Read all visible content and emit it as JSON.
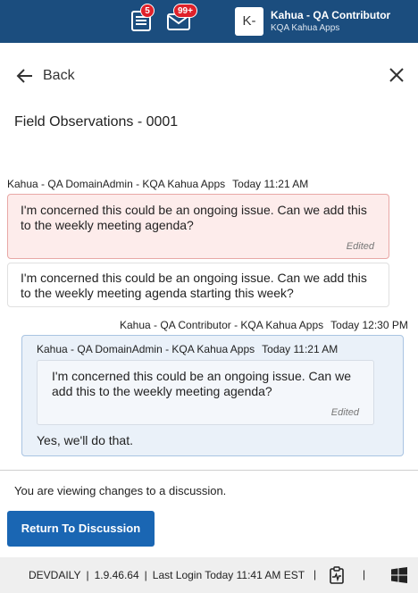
{
  "topbar": {
    "tasks_badge": "5",
    "messages_badge": "99+",
    "avatar_initials": "K-",
    "user_name": "Kahua - QA Contributor",
    "user_org": "KQA Kahua Apps"
  },
  "nav": {
    "back_label": "Back"
  },
  "page": {
    "title": "Field Observations - 0001"
  },
  "messages": [
    {
      "author": "Kahua - QA DomainAdmin - KQA Kahua Apps",
      "timestamp": "Today 11:21 AM",
      "original_text": "I'm concerned this could be an ongoing issue.  Can we add this to the weekly meeting agenda?",
      "edited_label": "Edited",
      "revised_text": "I'm concerned this could be an ongoing issue.  Can we add this to the weekly meeting agenda starting this week?"
    }
  ],
  "reply": {
    "author": "Kahua - QA Contributor - KQA Kahua Apps",
    "timestamp": "Today 12:30 PM",
    "quoted_author": "Kahua - QA DomainAdmin - KQA Kahua Apps",
    "quoted_timestamp": "Today 11:21 AM",
    "quoted_text": "I'm concerned this could be an ongoing issue.  Can we add this to the weekly meeting agenda?",
    "quoted_edited_label": "Edited",
    "text": "Yes, we'll do that."
  },
  "notice": {
    "text": "You are viewing changes to a discussion.",
    "button_label": "Return To Discussion"
  },
  "footer": {
    "environment": "DEVDAILY",
    "version": "1.9.46.64",
    "last_login": "Last Login Today 11:41 AM EST",
    "separator": "|"
  },
  "colors": {
    "header_bg": "#1b4d7e",
    "badge_red": "#e0212a",
    "primary_button": "#1a66b3",
    "edited_bubble_bg": "#fdeceb",
    "reply_bubble_bg": "#eaf1f9"
  },
  "icons": [
    "tasks-icon",
    "envelope-icon",
    "arrow-left-icon",
    "close-icon",
    "clipboard-pulse-icon",
    "windows-icon"
  ]
}
